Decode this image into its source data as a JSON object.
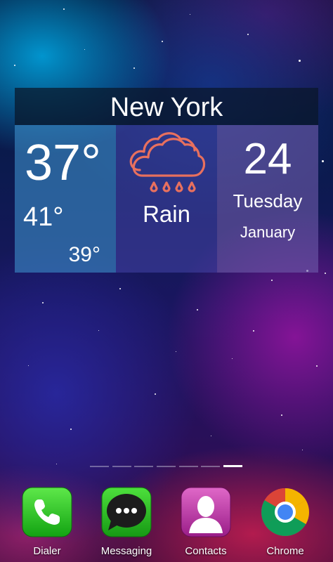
{
  "weather_widget": {
    "city": "New York",
    "current_temp": "37°",
    "high_temp": "41°",
    "low_temp": "39°",
    "condition": "Rain",
    "condition_icon": "rain-cloud-icon",
    "day_number": "24",
    "weekday": "Tuesday",
    "month": "January",
    "icon_color": "#e8705e"
  },
  "home_screen": {
    "page_count": 7,
    "active_page_index": 6
  },
  "dock": [
    {
      "label": "Dialer",
      "icon": "phone-icon",
      "color": "#2ecc2e"
    },
    {
      "label": "Messaging",
      "icon": "message-bubble-icon",
      "color": "#33cc22"
    },
    {
      "label": "Contacts",
      "icon": "person-icon",
      "color": "#c03aa8"
    },
    {
      "label": "Chrome",
      "icon": "chrome-icon",
      "color": "#db4437"
    }
  ]
}
